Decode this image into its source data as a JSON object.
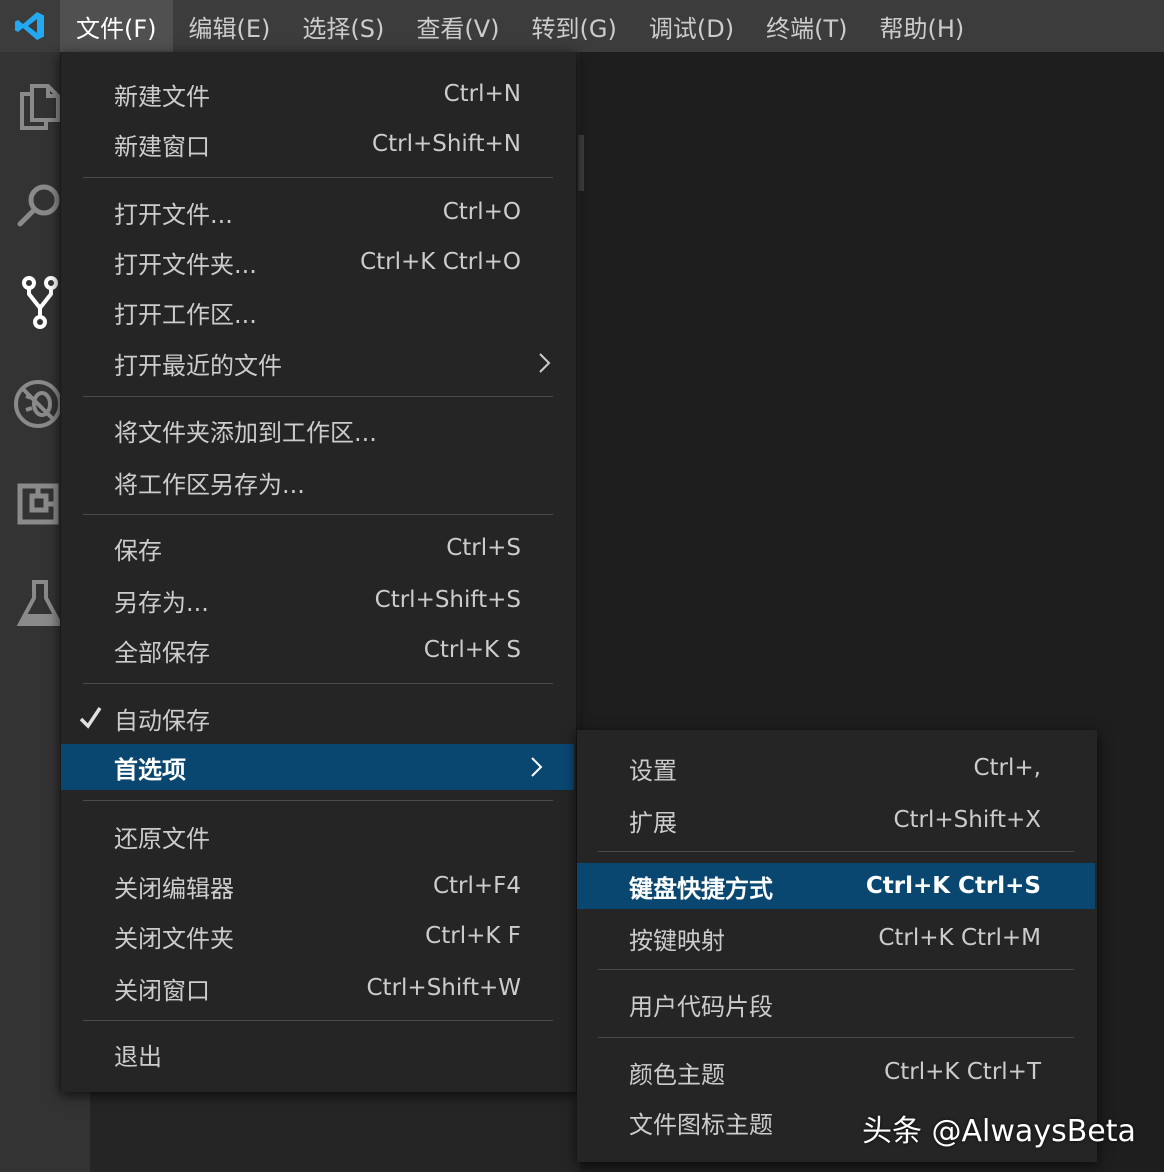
{
  "menubar": {
    "items": [
      {
        "label": "文件(F)",
        "active": true
      },
      {
        "label": "编辑(E)"
      },
      {
        "label": "选择(S)"
      },
      {
        "label": "查看(V)"
      },
      {
        "label": "转到(G)"
      },
      {
        "label": "调试(D)"
      },
      {
        "label": "终端(T)"
      },
      {
        "label": "帮助(H)"
      }
    ]
  },
  "activity_bar": {
    "icons": [
      "explorer-icon",
      "search-icon",
      "source-control-icon",
      "debug-icon",
      "extensions-icon",
      "testing-icon"
    ]
  },
  "file_menu": {
    "items": [
      {
        "label": "新建文件",
        "shortcut": "Ctrl+N"
      },
      {
        "label": "新建窗口",
        "shortcut": "Ctrl+Shift+N"
      },
      {
        "label": "打开文件...",
        "shortcut": "Ctrl+O"
      },
      {
        "label": "打开文件夹...",
        "shortcut": "Ctrl+K Ctrl+O"
      },
      {
        "label": "打开工作区..."
      },
      {
        "label": "打开最近的文件",
        "submenu": true
      },
      {
        "label": "将文件夹添加到工作区..."
      },
      {
        "label": "将工作区另存为..."
      },
      {
        "label": "保存",
        "shortcut": "Ctrl+S"
      },
      {
        "label": "另存为...",
        "shortcut": "Ctrl+Shift+S"
      },
      {
        "label": "全部保存",
        "shortcut": "Ctrl+K S"
      },
      {
        "label": "自动保存",
        "checked": true
      },
      {
        "label": "首选项",
        "submenu": true,
        "highlighted": true
      },
      {
        "label": "还原文件"
      },
      {
        "label": "关闭编辑器",
        "shortcut": "Ctrl+F4"
      },
      {
        "label": "关闭文件夹",
        "shortcut": "Ctrl+K F"
      },
      {
        "label": "关闭窗口",
        "shortcut": "Ctrl+Shift+W"
      },
      {
        "label": "退出"
      }
    ]
  },
  "preferences_menu": {
    "items": [
      {
        "label": "设置",
        "shortcut": "Ctrl+,"
      },
      {
        "label": "扩展",
        "shortcut": "Ctrl+Shift+X"
      },
      {
        "label": "键盘快捷方式",
        "shortcut": "Ctrl+K Ctrl+S",
        "highlighted": true
      },
      {
        "label": "按键映射",
        "shortcut": "Ctrl+K Ctrl+M"
      },
      {
        "label": "用户代码片段"
      },
      {
        "label": "颜色主题",
        "shortcut": "Ctrl+K Ctrl+T"
      },
      {
        "label": "文件图标主题"
      }
    ]
  },
  "watermark": "头条 @AlwaysBeta",
  "colors": {
    "menubar_bg": "#3c3c3c",
    "menu_bg": "#252526",
    "highlight_bg": "#094771",
    "text": "#cccccc",
    "logo_blue": "#23a9f2"
  }
}
